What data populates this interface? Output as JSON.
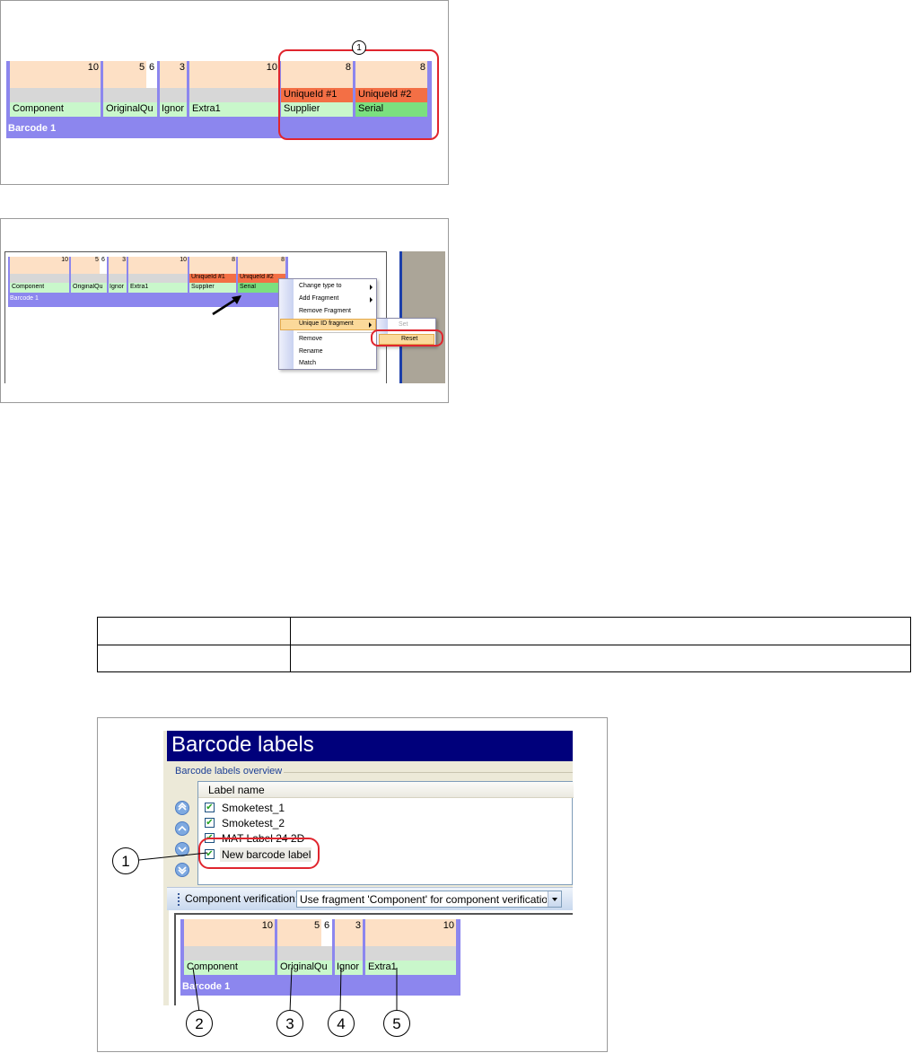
{
  "figure1": {
    "barcode_title": "Barcode 1",
    "fragments": [
      {
        "name": "Component",
        "length": "10"
      },
      {
        "name": "OriginalQu",
        "length": "5",
        "extra": "6"
      },
      {
        "name": "Ignor",
        "length": "3"
      },
      {
        "name": "Extra1",
        "length": "10"
      },
      {
        "name": "Supplier",
        "length": "8",
        "unique": "UniqueId #1"
      },
      {
        "name": "Serial",
        "length": "8",
        "unique": "UniqueId #2"
      }
    ],
    "callout": "1"
  },
  "figure2": {
    "barcode_title": "Barcode 1",
    "fragments": [
      {
        "name": "Component",
        "length": "10"
      },
      {
        "name": "OriginalQu",
        "length": "5",
        "extra": "6"
      },
      {
        "name": "Ignor",
        "length": "3"
      },
      {
        "name": "Extra1",
        "length": "10"
      },
      {
        "name": "Supplier",
        "length": "8",
        "unique": "UniqueId #1"
      },
      {
        "name": "Serial",
        "length": "8",
        "unique": "UniqueId #2"
      }
    ],
    "context_menu": [
      "Change type to",
      "Add Fragment",
      "Remove Fragment",
      "Unique ID fragment",
      "Remove",
      "Rename",
      "Match"
    ],
    "submenu": [
      "Set",
      "Reset"
    ]
  },
  "table": {
    "rows": [
      [
        "",
        ""
      ],
      [
        "",
        ""
      ]
    ]
  },
  "figure3": {
    "title": "Barcode labels",
    "group_title": "Barcode labels overview",
    "column_header": "Label name",
    "labels": [
      "Smoketest_1",
      "Smoketest_2",
      "MAT Label 24 2D",
      "New barcode label"
    ],
    "verification_label": "Component verification:",
    "verification_value": "Use fragment 'Component' for component verification",
    "barcode_title": "Barcode 1",
    "fragments": [
      {
        "name": "Component",
        "length": "10"
      },
      {
        "name": "OriginalQu",
        "length": "5",
        "extra": "6"
      },
      {
        "name": "Ignor",
        "length": "3"
      },
      {
        "name": "Extra1",
        "length": "10"
      }
    ],
    "callouts": [
      "1",
      "2",
      "3",
      "4",
      "5"
    ]
  }
}
